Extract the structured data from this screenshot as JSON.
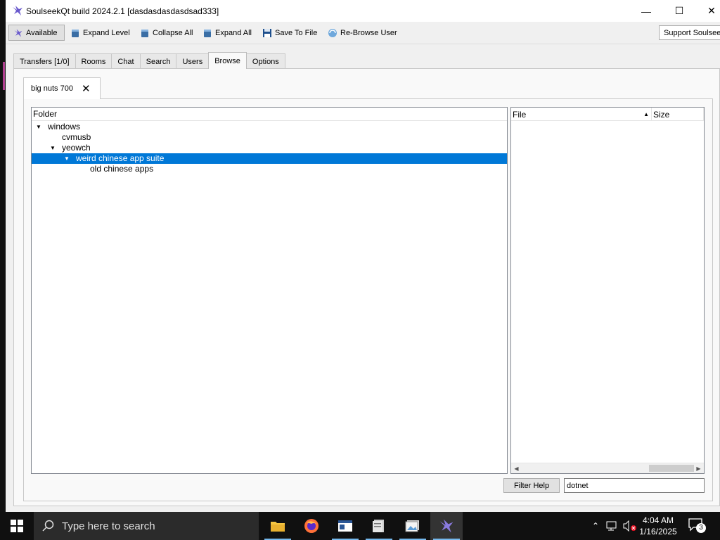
{
  "window": {
    "title": "SoulseekQt build 2024.2.1 [dasdasdasdasdsad333]",
    "controls": {
      "minimize": "—",
      "maximize": "☐",
      "close": "✕"
    }
  },
  "toolbar": {
    "available_label": "Available",
    "expand_level_label": "Expand Level",
    "collapse_all_label": "Collapse All",
    "expand_all_label": "Expand All",
    "save_to_file_label": "Save To File",
    "rebrowse_label": "Re-Browse User",
    "support_label": "Support Soulseek"
  },
  "tabs": [
    {
      "label": "Transfers [1/0]"
    },
    {
      "label": "Rooms"
    },
    {
      "label": "Chat"
    },
    {
      "label": "Search"
    },
    {
      "label": "Users"
    },
    {
      "label": "Browse",
      "active": true
    },
    {
      "label": "Options"
    }
  ],
  "browse": {
    "user_tab_label": "big nuts 700",
    "close_glyph": "✕",
    "folder_header": "Folder",
    "tree": [
      {
        "label": "windows",
        "expanded": true
      },
      {
        "label": "cvmusb"
      },
      {
        "label": "yeowch",
        "expanded": true
      },
      {
        "label": "weird chinese app suite",
        "expanded": true,
        "selected": true
      },
      {
        "label": "old chinese apps"
      }
    ],
    "file_headers": {
      "file": "File",
      "size": "Size"
    },
    "filter_help_label": "Filter Help",
    "filter_value": "dotnet"
  },
  "taskbar": {
    "search_placeholder": "Type here to search",
    "time": "4:04 AM",
    "date": "1/16/2025",
    "notification_count": "3"
  },
  "colors": {
    "selection": "#0078d7",
    "window_bg": "#f0f0f0",
    "taskbar_bg": "#101010"
  }
}
